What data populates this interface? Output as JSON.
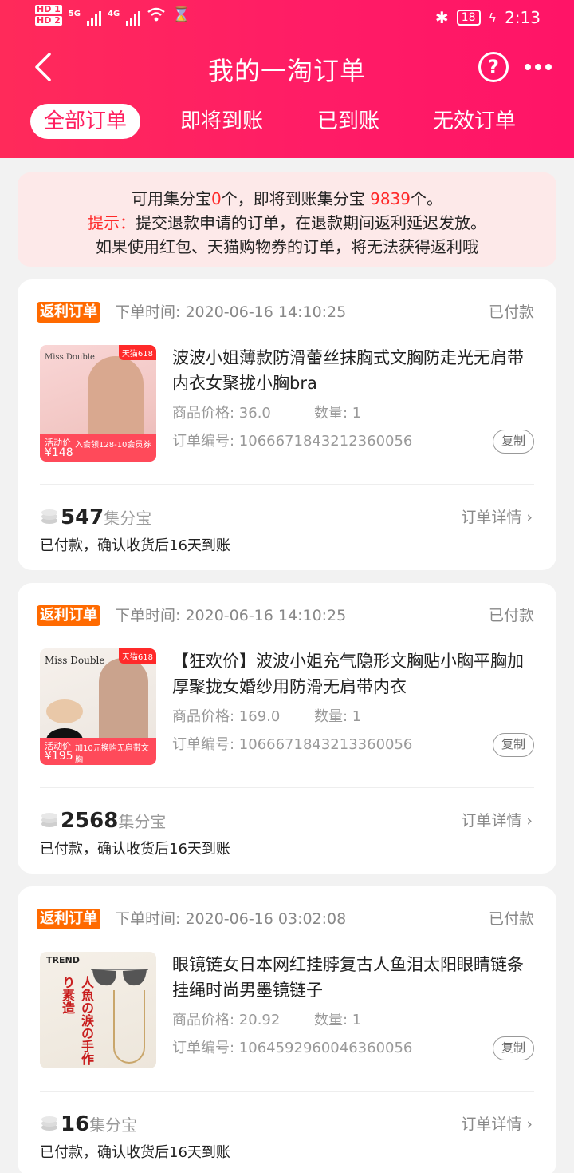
{
  "status_bar": {
    "left_tags": [
      "HD 1",
      "HD 2"
    ],
    "net1": "5G",
    "net2": "4G",
    "battery": "18",
    "time": "2:13"
  },
  "nav": {
    "title": "我的一淘订单",
    "help_icon": "?"
  },
  "tabs": [
    {
      "label": "全部订单",
      "active": true
    },
    {
      "label": "即将到账",
      "active": false
    },
    {
      "label": "已到账",
      "active": false
    },
    {
      "label": "无效订单",
      "active": false
    }
  ],
  "notice": {
    "line1_a": "可用集分宝",
    "line1_b": "0",
    "line1_c": "个，即将到账集分宝 ",
    "line1_d": "9839",
    "line1_e": "个。",
    "line2_a": "提示：",
    "line2_b": "提交退款申请的订单，在退款期间返利延迟发放。",
    "line3": "如果使用红包、天猫购物券的订单，将无法获得返利哦"
  },
  "orders": [
    {
      "tag": "返利订单",
      "time": "下单时间: 2020-06-16 14:10:25",
      "status": "已付款",
      "title": "波波小姐薄款防滑蕾丝抹胸式文胸防走光无肩带内衣女聚拢小胸bra",
      "price": "商品价格: 36.0",
      "qty": "数量: 1",
      "order_no": "订单编号: 1066671843212360056",
      "copy": "复制",
      "points": "547",
      "points_unit": "集分宝",
      "detail": "订单详情",
      "note": "已付款，确认收货后16天到账",
      "thumb": {
        "badge": "天猫618",
        "brand": "Miss Double",
        "price_label": "活动价",
        "price": "¥148",
        "banner": "入会领128-10会员券"
      }
    },
    {
      "tag": "返利订单",
      "time": "下单时间: 2020-06-16 14:10:25",
      "status": "已付款",
      "title": "【狂欢价】波波小姐充气隐形文胸贴小胸平胸加厚聚拢女婚纱用防滑无肩带内衣",
      "price": "商品价格: 169.0",
      "qty": "数量: 1",
      "order_no": "订单编号: 1066671843213360056",
      "copy": "复制",
      "points": "2568",
      "points_unit": "集分宝",
      "detail": "订单详情",
      "note": "已付款，确认收货后16天到账",
      "thumb": {
        "badge": "天猫618",
        "brand": "Miss Double",
        "price_label": "活动价",
        "price": "¥195",
        "banner": "加10元换购无肩带文胸"
      }
    },
    {
      "tag": "返利订单",
      "time": "下单时间: 2020-06-16 03:02:08",
      "status": "已付款",
      "title": "眼镜链女日本网红挂脖复古人鱼泪太阳眼睛链条挂绳时尚男墨镜链子",
      "price": "商品价格: 20.92",
      "qty": "数量: 1",
      "order_no": "订单编号: 1064592960046360056",
      "copy": "复制",
      "points": "16",
      "points_unit": "集分宝",
      "detail": "订单详情",
      "note": "已付款，确认收货后16天到账",
      "thumb": {
        "brand": "TREND",
        "vertical": "人魚の涙の手作り素造"
      }
    }
  ],
  "colors": {
    "brand": "#ff1f5f",
    "tag": "#ff6a00",
    "highlight": "#ff2a2a"
  }
}
